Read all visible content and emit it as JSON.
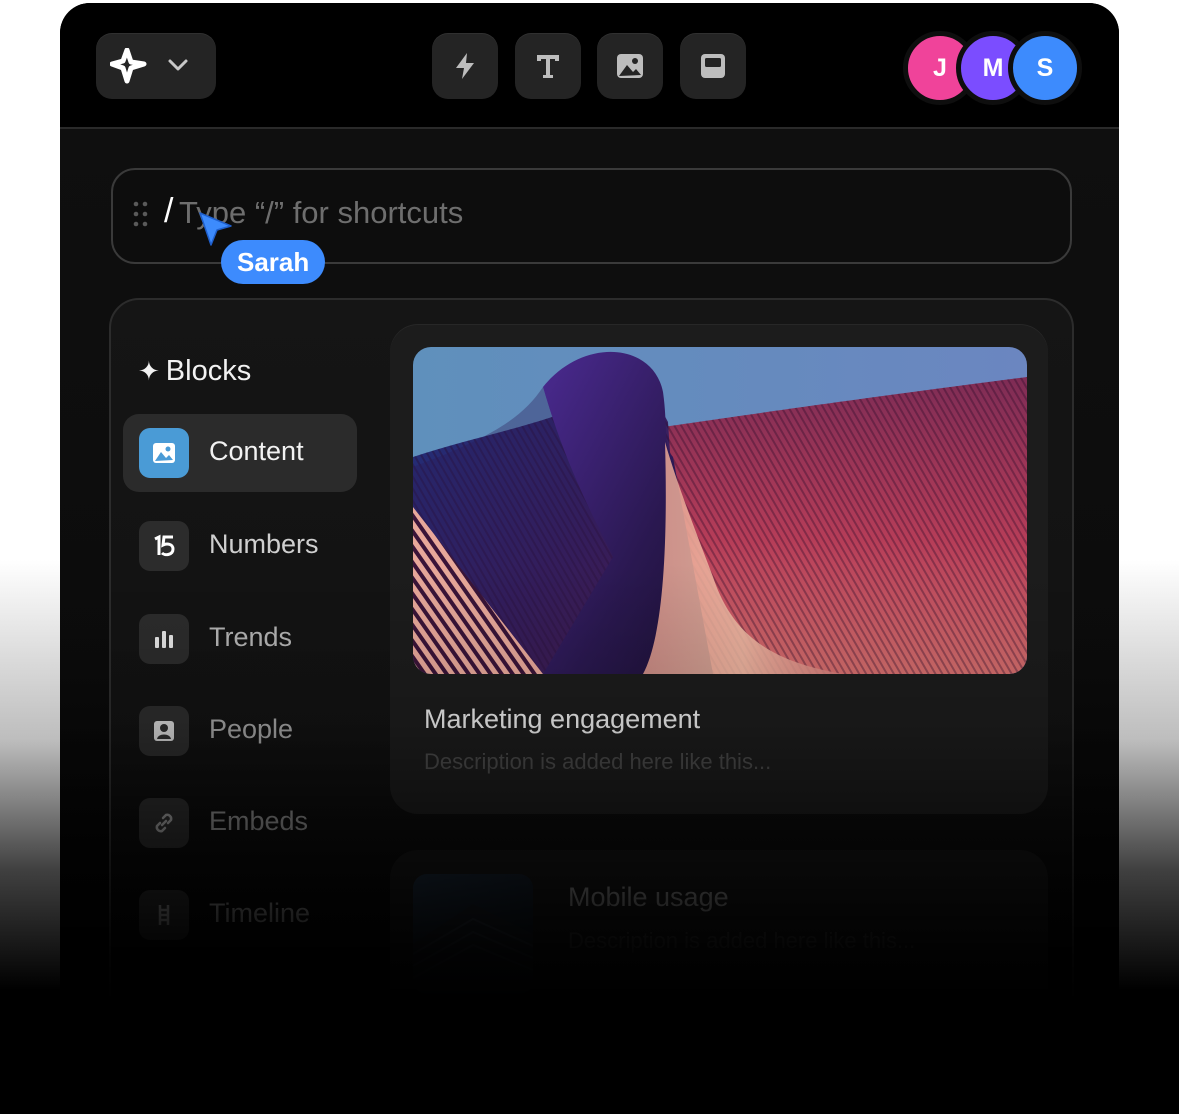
{
  "colors": {
    "accent_blue": "#3d8bfd",
    "avatar_j": "#f0439a",
    "avatar_m": "#7b4dff",
    "avatar_s": "#3d8bfd"
  },
  "toolbar": {
    "logo_icon": "sparkle-icon",
    "dropdown_icon": "chevron-down-icon",
    "tools": [
      "lightning-icon",
      "text-icon",
      "image-icon",
      "layout-icon"
    ]
  },
  "collaborators": [
    {
      "initial": "J",
      "color": "#f0439a"
    },
    {
      "initial": "M",
      "color": "#7b4dff"
    },
    {
      "initial": "S",
      "color": "#3d8bfd"
    }
  ],
  "command_bar": {
    "typed": "/",
    "placeholder": "Type “/” for shortcuts",
    "cursor_user": "Sarah"
  },
  "sidebar": {
    "title": "Blocks",
    "items": [
      {
        "label": "Content",
        "icon": "image-icon",
        "active": true
      },
      {
        "label": "Numbers",
        "icon": "number-15-icon"
      },
      {
        "label": "Trends",
        "icon": "bar-chart-icon"
      },
      {
        "label": "People",
        "icon": "person-icon"
      },
      {
        "label": "Embeds",
        "icon": "link-icon"
      },
      {
        "label": "Timeline",
        "icon": "timeline-icon"
      }
    ]
  },
  "cards": [
    {
      "title": "Marketing engagement",
      "description": "Description is added here like this..."
    },
    {
      "title": "Mobile usage",
      "description": "Description is added here like this..."
    }
  ]
}
